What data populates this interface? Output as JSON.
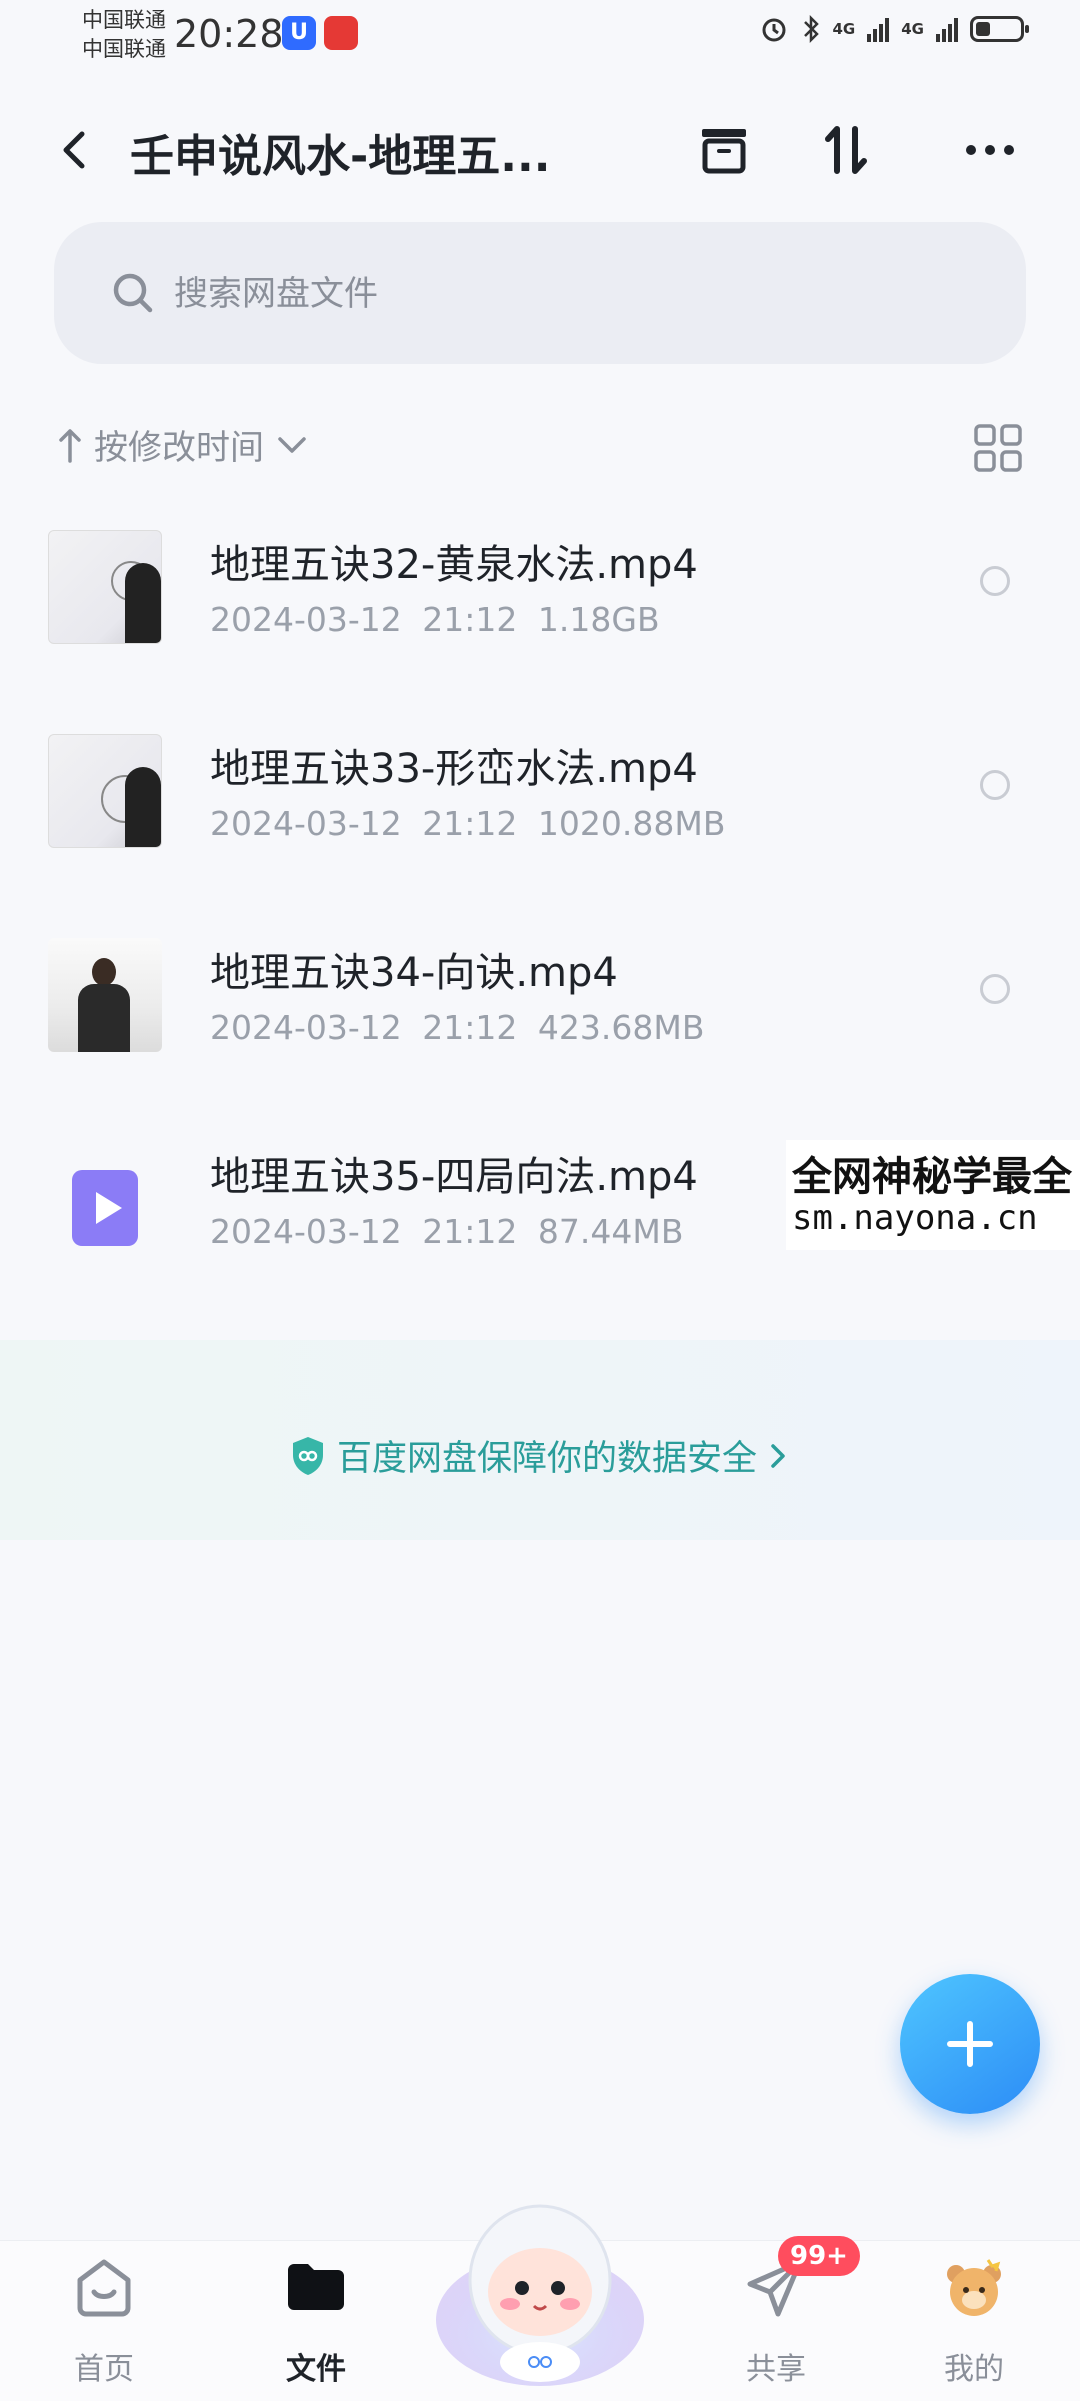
{
  "status_bar": {
    "carrier_1": "中国联通",
    "carrier_2": "中国联通",
    "time": "20:28",
    "net_1": "4G",
    "net_2": "4G"
  },
  "header": {
    "title": "壬申说风水-地理五..."
  },
  "search": {
    "placeholder": "搜索网盘文件"
  },
  "sort": {
    "label": "按修改时间"
  },
  "files": [
    {
      "name": "地理五诀32-黄泉水法.mp4",
      "date": "2024-03-12",
      "time": "21:12",
      "size": "1.18GB",
      "thumbnail": "whiteboard"
    },
    {
      "name": "地理五诀33-形峦水法.mp4",
      "date": "2024-03-12",
      "time": "21:12",
      "size": "1020.88MB",
      "thumbnail": "whiteboard"
    },
    {
      "name": "地理五诀34-向诀.mp4",
      "date": "2024-03-12",
      "time": "21:12",
      "size": "423.68MB",
      "thumbnail": "presenter"
    },
    {
      "name": "地理五诀35-四局向法.mp4",
      "date": "2024-03-12",
      "time": "21:12",
      "size": "87.44MB",
      "thumbnail": "video-icon"
    }
  ],
  "watermark": {
    "line1": "全网神秘学最全",
    "line2": "sm.nayona.cn"
  },
  "security_banner": {
    "text": "百度网盘保障你的数据安全"
  },
  "tabbar": {
    "home": "首页",
    "files": "文件",
    "share": "共享",
    "share_badge": "99+",
    "mine": "我的"
  },
  "colors": {
    "accent": "#2c8cf6",
    "security_text": "#2a9d9a",
    "badge": "#ff4d5e"
  }
}
